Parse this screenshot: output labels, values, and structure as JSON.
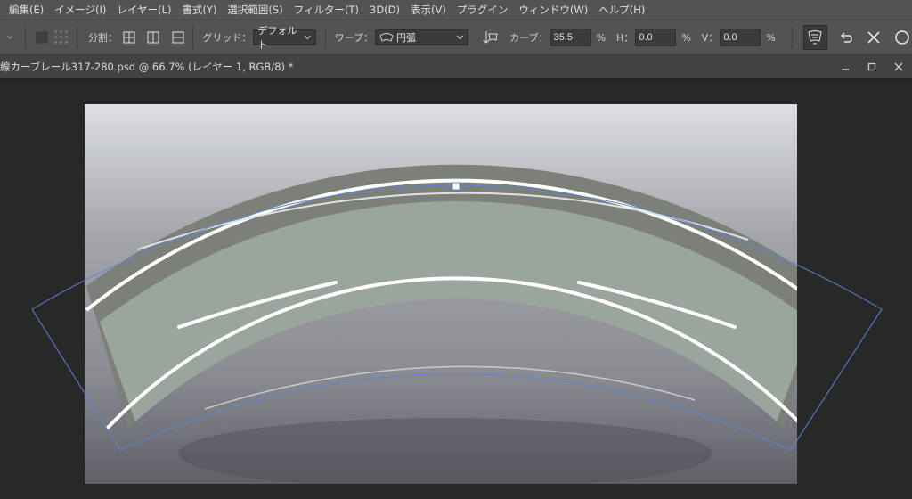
{
  "menubar": {
    "items": [
      "編集(E)",
      "イメージ(I)",
      "レイヤー(L)",
      "書式(Y)",
      "選択範囲(S)",
      "フィルター(T)",
      "3D(D)",
      "表示(V)",
      "プラグイン",
      "ウィンドウ(W)",
      "ヘルプ(H)"
    ]
  },
  "options": {
    "split_label": "分割：",
    "grid_label": "グリッド：",
    "grid_value": "デフォルト",
    "warp_label": "ワープ：",
    "warp_value": "円弧",
    "bend_label": "カーブ：",
    "bend_value": "35.5",
    "bend_unit": "%",
    "h_label": "H：",
    "h_value": "0.0",
    "h_unit": "%",
    "v_label": "V：",
    "v_value": "0.0",
    "v_unit": "%"
  },
  "document": {
    "tab_title": "線カーブレール317-280.psd @ 66.7% (レイヤー 1, RGB/8) *"
  }
}
